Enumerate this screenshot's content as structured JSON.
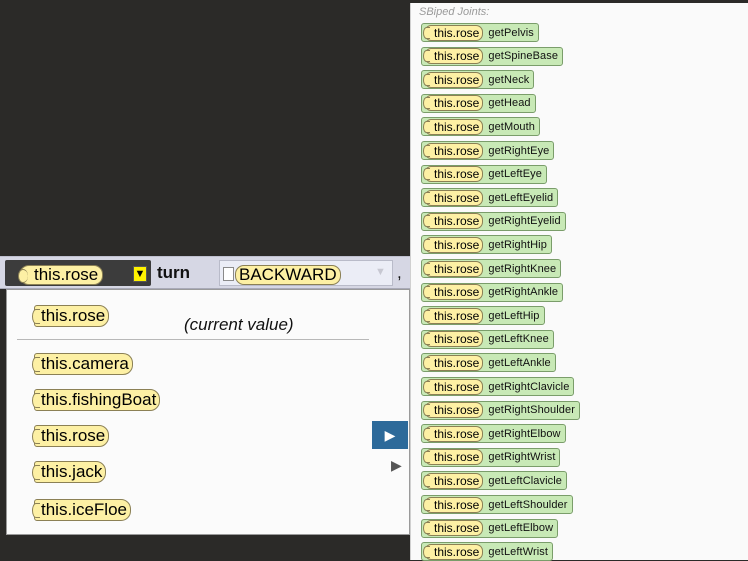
{
  "statement": {
    "subject": "this.rose",
    "caret": "▼",
    "method": "turn",
    "direction": "BACKWARD",
    "direction_caret": "▼",
    "comma": ","
  },
  "menu": {
    "current": {
      "label": "this.rose",
      "note": "(current value)"
    },
    "items": [
      {
        "label": "this.camera"
      },
      {
        "label": "this.fishingBoat"
      },
      {
        "label": "this.rose",
        "arrow": "▶"
      },
      {
        "label": "this.jack",
        "arrow": "▶"
      },
      {
        "label": "this.iceFloe"
      }
    ]
  },
  "joints": {
    "heading": "SBiped Joints:",
    "subject": "this.rose",
    "items": [
      "getPelvis",
      "getSpineBase",
      "getNeck",
      "getHead",
      "getMouth",
      "getRightEye",
      "getLeftEye",
      "getLeftEyelid",
      "getRightEyelid",
      "getRightHip",
      "getRightKnee",
      "getRightAnkle",
      "getLeftHip",
      "getLeftKnee",
      "getLeftAnkle",
      "getRightClavicle",
      "getRightShoulder",
      "getRightElbow",
      "getRightWrist",
      "getLeftClavicle",
      "getLeftShoulder",
      "getLeftElbow",
      "getLeftWrist"
    ]
  },
  "colors": {
    "tile": "#fdf0a4",
    "joint_tile": "#c8e9b6",
    "highlight": "#2d6a9a",
    "background": "#2b2a28"
  }
}
